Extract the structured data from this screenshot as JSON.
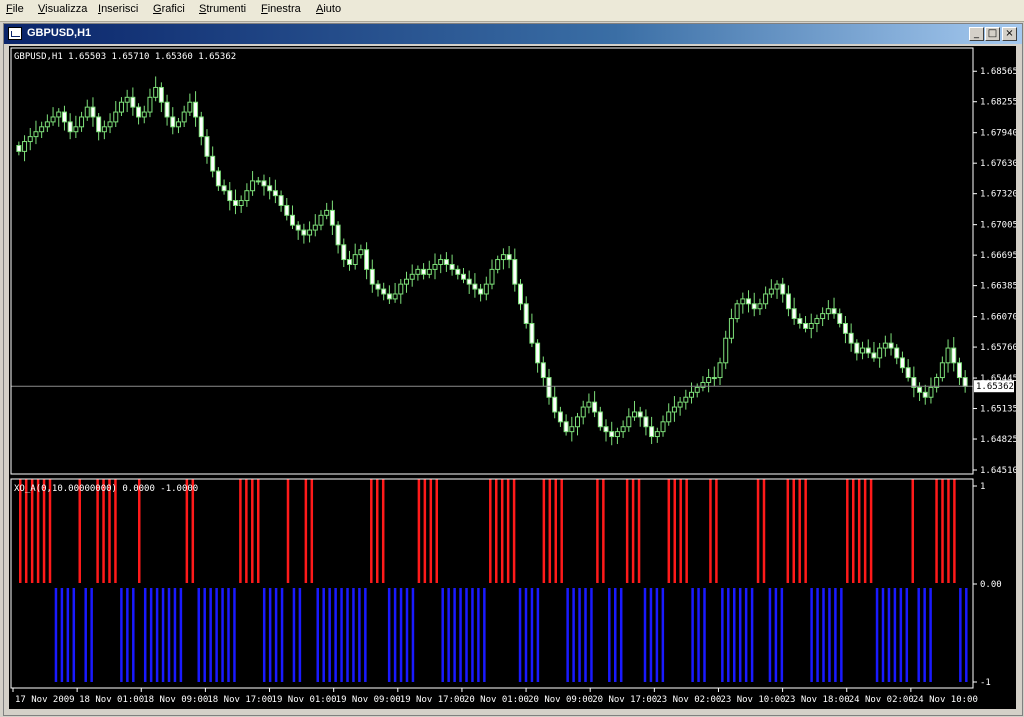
{
  "menu": [
    "File",
    "Visualizza",
    "Inserisci",
    "Grafici",
    "Strumenti",
    "Finestra",
    "Aiuto"
  ],
  "window": {
    "title": "GBPUSD,H1",
    "buttons": {
      "minimize": "_",
      "maximize": "□",
      "close": "×"
    }
  },
  "colors": {
    "background": "#000000",
    "candle": "#7ee07a",
    "grid": "#ffffff",
    "bar_up": "#ff1a1a",
    "bar_down": "#1a1aff",
    "bid_line": "#8c8c8c"
  },
  "main_chart": {
    "info": "GBPUSD,H1  1.65503 1.65710 1.65360 1.65362",
    "current_price": "1.65362"
  },
  "indicator": {
    "label": "XO_A(0,10.00000000) 0.0000 -1.0000",
    "axis_labels": [
      "1",
      "0.00",
      "-1"
    ]
  },
  "time_labels": [
    "17 Nov 2009",
    "18 Nov 01:00",
    "18 Nov 09:00",
    "18 Nov 17:00",
    "19 Nov 01:00",
    "19 Nov 09:00",
    "19 Nov 17:00",
    "20 Nov 01:00",
    "20 Nov 09:00",
    "20 Nov 17:00",
    "23 Nov 02:00",
    "23 Nov 10:00",
    "23 Nov 18:00",
    "24 Nov 02:00",
    "24 Nov 10:00"
  ],
  "chart_data": [
    {
      "type": "candlestick",
      "title": "GBPUSD,H1",
      "ylim": [
        1.6451,
        1.6872
      ],
      "y_ticks": [
        1.68565,
        1.68255,
        1.6794,
        1.6763,
        1.6732,
        1.67005,
        1.66695,
        1.66385,
        1.6607,
        1.6576,
        1.65445,
        1.65135,
        1.64825,
        1.6451
      ],
      "close_series": [
        1.6775,
        1.6785,
        1.679,
        1.6795,
        1.68,
        1.6805,
        1.681,
        1.6815,
        1.6805,
        1.6795,
        1.68,
        1.681,
        1.682,
        1.681,
        1.6795,
        1.68,
        1.6805,
        1.6815,
        1.6825,
        1.683,
        1.682,
        1.681,
        1.6815,
        1.683,
        1.684,
        1.6825,
        1.681,
        1.68,
        1.6805,
        1.6815,
        1.6825,
        1.681,
        1.679,
        1.677,
        1.6755,
        1.674,
        1.6735,
        1.6725,
        1.672,
        1.6725,
        1.6735,
        1.6745,
        1.6745,
        1.674,
        1.6735,
        1.673,
        1.672,
        1.671,
        1.67,
        1.6695,
        1.669,
        1.6695,
        1.67,
        1.671,
        1.6715,
        1.67,
        1.668,
        1.6665,
        1.666,
        1.667,
        1.6675,
        1.6655,
        1.664,
        1.6635,
        1.663,
        1.6625,
        1.663,
        1.664,
        1.6645,
        1.665,
        1.6655,
        1.665,
        1.6655,
        1.666,
        1.6665,
        1.666,
        1.6655,
        1.665,
        1.6645,
        1.664,
        1.6635,
        1.663,
        1.664,
        1.6655,
        1.6665,
        1.667,
        1.6665,
        1.664,
        1.662,
        1.66,
        1.658,
        1.656,
        1.6545,
        1.6525,
        1.651,
        1.65,
        1.649,
        1.6495,
        1.6505,
        1.6515,
        1.652,
        1.651,
        1.6495,
        1.649,
        1.6485,
        1.649,
        1.6495,
        1.6505,
        1.651,
        1.6505,
        1.6495,
        1.6485,
        1.649,
        1.65,
        1.651,
        1.6515,
        1.652,
        1.6525,
        1.653,
        1.6535,
        1.654,
        1.6545,
        1.6545,
        1.656,
        1.6585,
        1.6605,
        1.662,
        1.6625,
        1.662,
        1.6615,
        1.662,
        1.663,
        1.6635,
        1.664,
        1.663,
        1.6615,
        1.6605,
        1.66,
        1.6595,
        1.66,
        1.6605,
        1.661,
        1.6615,
        1.661,
        1.66,
        1.659,
        1.658,
        1.657,
        1.6575,
        1.657,
        1.6565,
        1.6575,
        1.658,
        1.6575,
        1.6565,
        1.6555,
        1.6545,
        1.6535,
        1.653,
        1.6525,
        1.6535,
        1.6545,
        1.656,
        1.6575,
        1.656,
        1.6545,
        1.6536
      ]
    },
    {
      "type": "bar",
      "title": "XO_A(0,10.00000000) 0.0000 -1.0000",
      "ylim": [
        -1,
        1
      ],
      "values": [
        1,
        1,
        1,
        1,
        1,
        1,
        -1,
        -1,
        -1,
        -1,
        1,
        -1,
        -1,
        1,
        1,
        1,
        1,
        -1,
        -1,
        -1,
        1,
        -1,
        -1,
        -1,
        -1,
        -1,
        -1,
        -1,
        1,
        1,
        -1,
        -1,
        -1,
        -1,
        -1,
        -1,
        -1,
        1,
        1,
        1,
        1,
        -1,
        -1,
        -1,
        -1,
        1,
        -1,
        -1,
        1,
        1,
        -1,
        -1,
        -1,
        -1,
        -1,
        -1,
        -1,
        -1,
        -1,
        1,
        1,
        1,
        -1,
        -1,
        -1,
        -1,
        -1,
        1,
        1,
        1,
        1,
        -1,
        -1,
        -1,
        -1,
        -1,
        -1,
        -1,
        -1,
        1,
        1,
        1,
        1,
        1,
        -1,
        -1,
        -1,
        -1,
        1,
        1,
        1,
        1,
        -1,
        -1,
        -1,
        -1,
        -1,
        1,
        1,
        -1,
        -1,
        -1,
        1,
        1,
        1,
        -1,
        -1,
        -1,
        -1,
        1,
        1,
        1,
        1,
        -1,
        -1,
        -1,
        1,
        1,
        -1,
        -1,
        -1,
        -1,
        -1,
        -1,
        1,
        1,
        -1,
        -1,
        -1,
        1,
        1,
        1,
        1,
        -1,
        -1,
        -1,
        -1,
        -1,
        -1,
        1,
        1,
        1,
        1,
        1,
        -1,
        -1,
        -1,
        -1,
        -1,
        -1,
        1,
        -1,
        -1,
        -1,
        1,
        1,
        1,
        1,
        -1,
        -1
      ]
    }
  ]
}
